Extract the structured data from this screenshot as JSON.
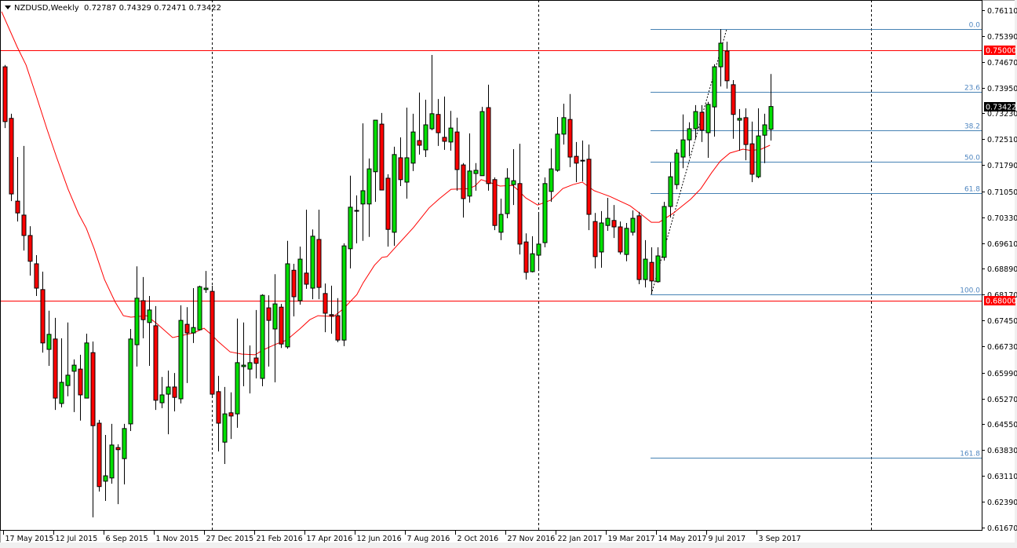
{
  "header": {
    "symbol_timeframe": "NZDUSD,Weekly",
    "ohlc": "0.72787 0.74329 0.72471 0.73422"
  },
  "colors": {
    "bull": "#00e000",
    "bear": "#ff0000",
    "ma": "#ff0000",
    "fib": "#4682b4",
    "hline": "#ff0000",
    "price_tag": "#000000"
  },
  "chart_data": {
    "type": "candlestick",
    "title": "NZDUSD,Weekly",
    "ylim": [
      0.6162,
      0.764
    ],
    "y_ticks": [
      "0.76110",
      "0.75390",
      "0.74670",
      "0.73950",
      "0.73230",
      "0.72510",
      "0.71790",
      "0.71050",
      "0.70330",
      "0.69610",
      "0.68890",
      "0.68170",
      "0.67450",
      "0.66730",
      "0.65990",
      "0.65270",
      "0.64550",
      "0.63830",
      "0.63110",
      "0.62390",
      "0.61670"
    ],
    "x_labels": [
      {
        "index": 1,
        "text": "17 May 2015"
      },
      {
        "index": 9,
        "text": "12 Jul 2015"
      },
      {
        "index": 17,
        "text": "6 Sep 2015"
      },
      {
        "index": 25,
        "text": "1 Nov 2015"
      },
      {
        "index": 33,
        "text": "27 Dec 2015"
      },
      {
        "index": 41,
        "text": "21 Feb 2016"
      },
      {
        "index": 49,
        "text": "17 Apr 2016"
      },
      {
        "index": 57,
        "text": "12 Jun 2016"
      },
      {
        "index": 65,
        "text": "7 Aug 2016"
      },
      {
        "index": 73,
        "text": "2 Oct 2016"
      },
      {
        "index": 81,
        "text": "27 Nov 2016"
      },
      {
        "index": 89,
        "text": "22 Jan 2017"
      },
      {
        "index": 97,
        "text": "19 Mar 2017"
      },
      {
        "index": 105,
        "text": "14 May 2017"
      },
      {
        "index": 113,
        "text": "9 Jul 2017"
      },
      {
        "index": 121,
        "text": "3 Sep 2017"
      }
    ],
    "year_separators": [
      34,
      86,
      139
    ],
    "horizontal_lines": [
      {
        "price": 0.75,
        "label": "0.75000"
      },
      {
        "price": 0.68,
        "label": "0.68000"
      }
    ],
    "current_price": {
      "price": 0.73422,
      "label": "0.73422"
    },
    "fibonacci": {
      "from_index": 104,
      "to_index": 115,
      "start_index": 104,
      "levels": [
        {
          "label": "0.0",
          "price": 0.7558
        },
        {
          "label": "23.6",
          "price": 0.7383
        },
        {
          "label": "38.2",
          "price": 0.7275
        },
        {
          "label": "50.0",
          "price": 0.7188
        },
        {
          "label": "61.8",
          "price": 0.7101
        },
        {
          "label": "100.0",
          "price": 0.6818
        },
        {
          "label": "161.8",
          "price": 0.6361
        }
      ],
      "trend": [
        [
          104,
          0.6818
        ],
        [
          115,
          0.7558
        ]
      ]
    },
    "candles_ohlc": [
      [
        0.7453,
        0.7458,
        0.7282,
        0.73
      ],
      [
        0.7309,
        0.7322,
        0.7078,
        0.7098
      ],
      [
        0.7078,
        0.7201,
        0.7021,
        0.7045
      ],
      [
        0.7039,
        0.7232,
        0.694,
        0.6982
      ],
      [
        0.6982,
        0.7008,
        0.687,
        0.691
      ],
      [
        0.6903,
        0.6927,
        0.6813,
        0.6835
      ],
      [
        0.6831,
        0.6881,
        0.6655,
        0.6682
      ],
      [
        0.6664,
        0.6772,
        0.6618,
        0.6706
      ],
      [
        0.6693,
        0.6752,
        0.6495,
        0.6528
      ],
      [
        0.6513,
        0.6695,
        0.6502,
        0.6572
      ],
      [
        0.6563,
        0.6739,
        0.6533,
        0.6592
      ],
      [
        0.6603,
        0.6636,
        0.6489,
        0.662
      ],
      [
        0.6609,
        0.6649,
        0.6465,
        0.6537
      ],
      [
        0.6528,
        0.6708,
        0.6528,
        0.6682
      ],
      [
        0.6655,
        0.6686,
        0.6195,
        0.6451
      ],
      [
        0.6458,
        0.6467,
        0.6267,
        0.6281
      ],
      [
        0.6296,
        0.6425,
        0.6241,
        0.6311
      ],
      [
        0.6305,
        0.6456,
        0.6289,
        0.6397
      ],
      [
        0.639,
        0.6399,
        0.6232,
        0.6384
      ],
      [
        0.6359,
        0.6456,
        0.6287,
        0.6443
      ],
      [
        0.6456,
        0.6721,
        0.6436,
        0.6693
      ],
      [
        0.6677,
        0.6896,
        0.6616,
        0.6807
      ],
      [
        0.68,
        0.6866,
        0.6695,
        0.6747
      ],
      [
        0.6739,
        0.6813,
        0.6618,
        0.6774
      ],
      [
        0.673,
        0.6785,
        0.6495,
        0.6522
      ],
      [
        0.6515,
        0.6587,
        0.65,
        0.6537
      ],
      [
        0.6539,
        0.6605,
        0.6427,
        0.6559
      ],
      [
        0.6559,
        0.6598,
        0.6491,
        0.653
      ],
      [
        0.6526,
        0.6787,
        0.6513,
        0.6745
      ],
      [
        0.6734,
        0.6782,
        0.657,
        0.671
      ],
      [
        0.671,
        0.6835,
        0.6682,
        0.6725
      ],
      [
        0.6719,
        0.6842,
        0.6717,
        0.6839
      ],
      [
        0.6831,
        0.6883,
        0.6822,
        0.6835
      ],
      [
        0.6826,
        0.6842,
        0.6535,
        0.6539
      ],
      [
        0.6546,
        0.659,
        0.6379,
        0.6458
      ],
      [
        0.6405,
        0.6559,
        0.6344,
        0.6484
      ],
      [
        0.6487,
        0.6544,
        0.6414,
        0.6478
      ],
      [
        0.6484,
        0.675,
        0.6445,
        0.6627
      ],
      [
        0.6616,
        0.6739,
        0.6561,
        0.662
      ],
      [
        0.6609,
        0.6675,
        0.6541,
        0.6627
      ],
      [
        0.664,
        0.6774,
        0.6583,
        0.6625
      ],
      [
        0.6583,
        0.6818,
        0.6561,
        0.6815
      ],
      [
        0.678,
        0.6815,
        0.6616,
        0.6745
      ],
      [
        0.6721,
        0.6874,
        0.6572,
        0.6791
      ],
      [
        0.6782,
        0.6791,
        0.6668,
        0.6679
      ],
      [
        0.6671,
        0.6967,
        0.6666,
        0.6903
      ],
      [
        0.6885,
        0.6903,
        0.6756,
        0.6811
      ],
      [
        0.68,
        0.6951,
        0.6789,
        0.6916
      ],
      [
        0.6877,
        0.7054,
        0.6833,
        0.6846
      ],
      [
        0.6835,
        0.6999,
        0.6804,
        0.698
      ],
      [
        0.6971,
        0.7054,
        0.6804,
        0.6837
      ],
      [
        0.682,
        0.6848,
        0.6712,
        0.6765
      ],
      [
        0.6761,
        0.6842,
        0.6708,
        0.6758
      ],
      [
        0.6758,
        0.6807,
        0.6684,
        0.669
      ],
      [
        0.669,
        0.696,
        0.6673,
        0.6953
      ],
      [
        0.6945,
        0.7149,
        0.689,
        0.7061
      ],
      [
        0.705,
        0.7094,
        0.696,
        0.7052
      ],
      [
        0.707,
        0.7295,
        0.6967,
        0.7107
      ],
      [
        0.707,
        0.7197,
        0.6978,
        0.7168
      ],
      [
        0.716,
        0.7304,
        0.7076,
        0.7304
      ],
      [
        0.7293,
        0.7324,
        0.7109,
        0.7109
      ],
      [
        0.7142,
        0.7153,
        0.6951,
        0.6999
      ],
      [
        0.6991,
        0.723,
        0.6953,
        0.7208
      ],
      [
        0.7199,
        0.7256,
        0.712,
        0.7138
      ],
      [
        0.7131,
        0.7339,
        0.7085,
        0.7199
      ],
      [
        0.7184,
        0.7322,
        0.7162,
        0.7271
      ],
      [
        0.7247,
        0.7381,
        0.7208,
        0.7234
      ],
      [
        0.7221,
        0.7361,
        0.7201,
        0.7291
      ],
      [
        0.728,
        0.7486,
        0.7276,
        0.7322
      ],
      [
        0.732,
        0.7363,
        0.7232,
        0.7269
      ],
      [
        0.7256,
        0.737,
        0.7221,
        0.7245
      ],
      [
        0.7243,
        0.733,
        0.7219,
        0.7282
      ],
      [
        0.7271,
        0.7311,
        0.7107,
        0.7166
      ],
      [
        0.7179,
        0.7184,
        0.7032,
        0.7085
      ],
      [
        0.7092,
        0.7267,
        0.7074,
        0.7162
      ],
      [
        0.7155,
        0.7184,
        0.7107,
        0.7164
      ],
      [
        0.7149,
        0.7341,
        0.7149,
        0.7328
      ],
      [
        0.7339,
        0.7403,
        0.7107,
        0.7127
      ],
      [
        0.7138,
        0.7144,
        0.6997,
        0.701
      ],
      [
        0.6991,
        0.7085,
        0.6969,
        0.7041
      ],
      [
        0.7043,
        0.717,
        0.703,
        0.7142
      ],
      [
        0.7124,
        0.7223,
        0.7067,
        0.7135
      ],
      [
        0.7127,
        0.7238,
        0.6929,
        0.6958
      ],
      [
        0.6964,
        0.6988,
        0.6859,
        0.6879
      ],
      [
        0.6881,
        0.698,
        0.6879,
        0.6931
      ],
      [
        0.6927,
        0.7043,
        0.6883,
        0.6958
      ],
      [
        0.6962,
        0.7144,
        0.6949,
        0.7127
      ],
      [
        0.7105,
        0.7225,
        0.7076,
        0.7168
      ],
      [
        0.7164,
        0.7313,
        0.716,
        0.7265
      ],
      [
        0.7265,
        0.735,
        0.7236,
        0.7311
      ],
      [
        0.7306,
        0.7377,
        0.7173,
        0.7201
      ],
      [
        0.7203,
        0.7243,
        0.7131,
        0.7184
      ],
      [
        0.7192,
        0.7247,
        0.7133,
        0.7191
      ],
      [
        0.7195,
        0.7236,
        0.6997,
        0.7041
      ],
      [
        0.7021,
        0.7045,
        0.689,
        0.6923
      ],
      [
        0.6936,
        0.705,
        0.6892,
        0.7017
      ],
      [
        0.701,
        0.7087,
        0.6995,
        0.703
      ],
      [
        0.7024,
        0.7067,
        0.6975,
        0.7006
      ],
      [
        0.7006,
        0.7021,
        0.6929,
        0.6936
      ],
      [
        0.6929,
        0.7017,
        0.691,
        0.7002
      ],
      [
        0.6991,
        0.7052,
        0.6982,
        0.703
      ],
      [
        0.7037,
        0.7048,
        0.6846,
        0.6859
      ],
      [
        0.6859,
        0.6969,
        0.6837,
        0.6916
      ],
      [
        0.6907,
        0.6949,
        0.6818,
        0.6855
      ],
      [
        0.6853,
        0.6949,
        0.685,
        0.6925
      ],
      [
        0.6921,
        0.7076,
        0.6912,
        0.7063
      ],
      [
        0.7063,
        0.7186,
        0.7032,
        0.7146
      ],
      [
        0.7124,
        0.7223,
        0.7111,
        0.7212
      ],
      [
        0.7201,
        0.732,
        0.717,
        0.7249
      ],
      [
        0.7249,
        0.7298,
        0.7203,
        0.728
      ],
      [
        0.728,
        0.7346,
        0.7252,
        0.7328
      ],
      [
        0.7326,
        0.7346,
        0.7243,
        0.7276
      ],
      [
        0.7269,
        0.7355,
        0.7199,
        0.7348
      ],
      [
        0.7341,
        0.746,
        0.7258,
        0.7453
      ],
      [
        0.7453,
        0.7558,
        0.7398,
        0.7519
      ],
      [
        0.7497,
        0.7523,
        0.7392,
        0.7414
      ],
      [
        0.7403,
        0.7416,
        0.7252,
        0.732
      ],
      [
        0.7304,
        0.7335,
        0.7219,
        0.7309
      ],
      [
        0.7311,
        0.7337,
        0.7192,
        0.7236
      ],
      [
        0.7238,
        0.73,
        0.7131,
        0.7153
      ],
      [
        0.7146,
        0.7337,
        0.7142,
        0.726
      ],
      [
        0.7262,
        0.7322,
        0.7184,
        0.7291
      ],
      [
        0.72787,
        0.74329,
        0.72471,
        0.73422
      ]
    ],
    "moving_average": [
      [
        0.5,
        0.7607
      ],
      [
        3,
        0.7508
      ],
      [
        4.4,
        0.7458
      ],
      [
        6.1,
        0.7368
      ],
      [
        7.75,
        0.7278
      ],
      [
        9.25,
        0.7201
      ],
      [
        11.1,
        0.7111
      ],
      [
        12.75,
        0.7043
      ],
      [
        14,
        0.7002
      ],
      [
        15.25,
        0.6945
      ],
      [
        16.9,
        0.6859
      ],
      [
        18.6,
        0.6796
      ],
      [
        19.9,
        0.6758
      ],
      [
        21.1,
        0.6754
      ],
      [
        23.6,
        0.6758
      ],
      [
        25.25,
        0.6736
      ],
      [
        27.75,
        0.6697
      ],
      [
        31.1,
        0.671
      ],
      [
        32.75,
        0.6723
      ],
      [
        34,
        0.6704
      ],
      [
        35,
        0.6686
      ],
      [
        36.9,
        0.6657
      ],
      [
        38.75,
        0.6651
      ],
      [
        40.9,
        0.6649
      ],
      [
        42.1,
        0.6662
      ],
      [
        44.25,
        0.6679
      ],
      [
        45.9,
        0.669
      ],
      [
        48,
        0.6721
      ],
      [
        49.6,
        0.6747
      ],
      [
        50.9,
        0.6758
      ],
      [
        53.4,
        0.6756
      ],
      [
        55,
        0.6778
      ],
      [
        57.1,
        0.6817
      ],
      [
        58.1,
        0.685
      ],
      [
        59.9,
        0.6899
      ],
      [
        61.1,
        0.6921
      ],
      [
        61.9,
        0.6923
      ],
      [
        63.6,
        0.6956
      ],
      [
        66.1,
        0.7004
      ],
      [
        68.6,
        0.7059
      ],
      [
        70.25,
        0.7085
      ],
      [
        72.1,
        0.7111
      ],
      [
        74.9,
        0.7113
      ],
      [
        75.9,
        0.712
      ],
      [
        76.9,
        0.7138
      ],
      [
        78.1,
        0.7131
      ],
      [
        79.9,
        0.712
      ],
      [
        81.9,
        0.7122
      ],
      [
        82.75,
        0.7109
      ],
      [
        84,
        0.7087
      ],
      [
        85.9,
        0.7067
      ],
      [
        88,
        0.7081
      ],
      [
        89.9,
        0.7113
      ],
      [
        91.5,
        0.7124
      ],
      [
        93,
        0.7131
      ],
      [
        94.9,
        0.7107
      ],
      [
        97.4,
        0.7091
      ],
      [
        100.6,
        0.7065
      ],
      [
        102.4,
        0.7041
      ],
      [
        104,
        0.7019
      ],
      [
        105.25,
        0.7019
      ],
      [
        107.4,
        0.7043
      ],
      [
        110.25,
        0.7083
      ],
      [
        111.9,
        0.7113
      ],
      [
        113.6,
        0.7157
      ],
      [
        115,
        0.719
      ],
      [
        116.5,
        0.7212
      ],
      [
        118.6,
        0.7223
      ],
      [
        119.9,
        0.7219
      ],
      [
        121.5,
        0.7223
      ],
      [
        122.9,
        0.7234
      ]
    ]
  }
}
